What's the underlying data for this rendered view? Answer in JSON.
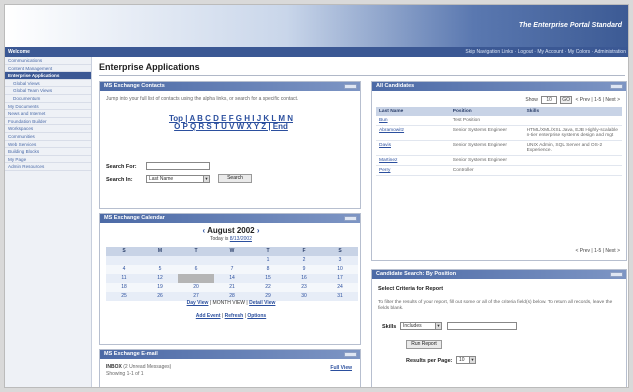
{
  "brand": "The Enterprise Portal Standard",
  "nav": {
    "welcome": "Welcome",
    "links": "Skip Navigation Links · Logout · My Account · My Colors · Administration"
  },
  "sidebar": {
    "items": [
      {
        "label": "Communications"
      },
      {
        "label": "Content Management"
      },
      {
        "label": "Enterprise Applications"
      },
      {
        "label": "Global Views"
      },
      {
        "label": "Global Team Views"
      },
      {
        "label": "Documentum"
      },
      {
        "label": "My Documents"
      },
      {
        "label": "News and Internet"
      },
      {
        "label": "Foundation Builder"
      },
      {
        "label": "Workspaces"
      },
      {
        "label": "Communities"
      },
      {
        "label": "Web Services"
      },
      {
        "label": "Building Blocks"
      },
      {
        "label": "My Page"
      },
      {
        "label": "Admin Resources"
      }
    ]
  },
  "page": {
    "title": "Enterprise Applications"
  },
  "contacts": {
    "title": "MS Exchange Contacts",
    "intro": "Jump into your full list of contacts using the alpha links, or search for a specific contact.",
    "alpha_row1": "Top | A B C D E F G H I J K L M N",
    "alpha_row2": "O P Q R S T U V W X Y Z | End",
    "search_for_label": "Search For:",
    "search_in_label": "Search In:",
    "search_in_value": "Last Name",
    "search_button": "Search"
  },
  "calendar": {
    "title": "MS Exchange Calendar",
    "month": "August 2002",
    "today_label": "Today is",
    "today_date": "8/13/2002",
    "weekdays": [
      "S",
      "M",
      "T",
      "W",
      "T",
      "F",
      "S"
    ],
    "weeks": [
      [
        "",
        "",
        "",
        "",
        "1",
        "2",
        "3"
      ],
      [
        "4",
        "5",
        "6",
        "7",
        "8",
        "9",
        "10"
      ],
      [
        "11",
        "12",
        "",
        "14",
        "15",
        "16",
        "17"
      ],
      [
        "18",
        "19",
        "20",
        "21",
        "22",
        "23",
        "24"
      ],
      [
        "25",
        "26",
        "27",
        "28",
        "29",
        "30",
        "31"
      ]
    ],
    "view_links": {
      "day": "Day View",
      "month": "MONTH VIEW",
      "detail": "Detail View"
    },
    "action_links": {
      "add": "Add Event",
      "refresh": "Refresh",
      "options": "Options"
    },
    "tooltip": "Minimize"
  },
  "email": {
    "title": "MS Exchange E-mail",
    "inbox": "INBOX",
    "unread": "(2 Unread Messages)",
    "showing": "Showing 1-1 of 1",
    "full_view": "Full View"
  },
  "candidates": {
    "title": "All Candidates",
    "show_label": "Show",
    "show_value": "10",
    "go": "GO",
    "pager": "< Prev | 1-5 | Next >",
    "columns": [
      "Last Name",
      "Position",
      "Skills"
    ],
    "rows": [
      {
        "name": "Bun",
        "position": "Test Position",
        "skills": ""
      },
      {
        "name": "Abramowitz",
        "position": "Senior Systems Engineer",
        "skills": "HTML/XML/XSL Java, EJB Highly-scalable n-tier enterprise systems design and mgt"
      },
      {
        "name": "Davis",
        "position": "Senior Systems Engineer",
        "skills": "UNIX Admin, SQL Server and OS-2 Experience."
      },
      {
        "name": "Martinez",
        "position": "Senior Systems Engineer",
        "skills": ""
      },
      {
        "name": "Perry",
        "position": "Controller",
        "skills": ""
      }
    ],
    "pager_bottom": "< Prev | 1-5 | Next >"
  },
  "search_position": {
    "title": "Candidate Search: By Position",
    "subtitle": "Select Criteria for Report",
    "help": "To filter the results of your report, fill out some or all of the criteria field(s) below. To return all records, leave the fields blank.",
    "skills_label": "Skills",
    "skills_op": "Includes",
    "run_button": "Run Report",
    "results_label": "Results per Page:",
    "results_value": "10"
  }
}
